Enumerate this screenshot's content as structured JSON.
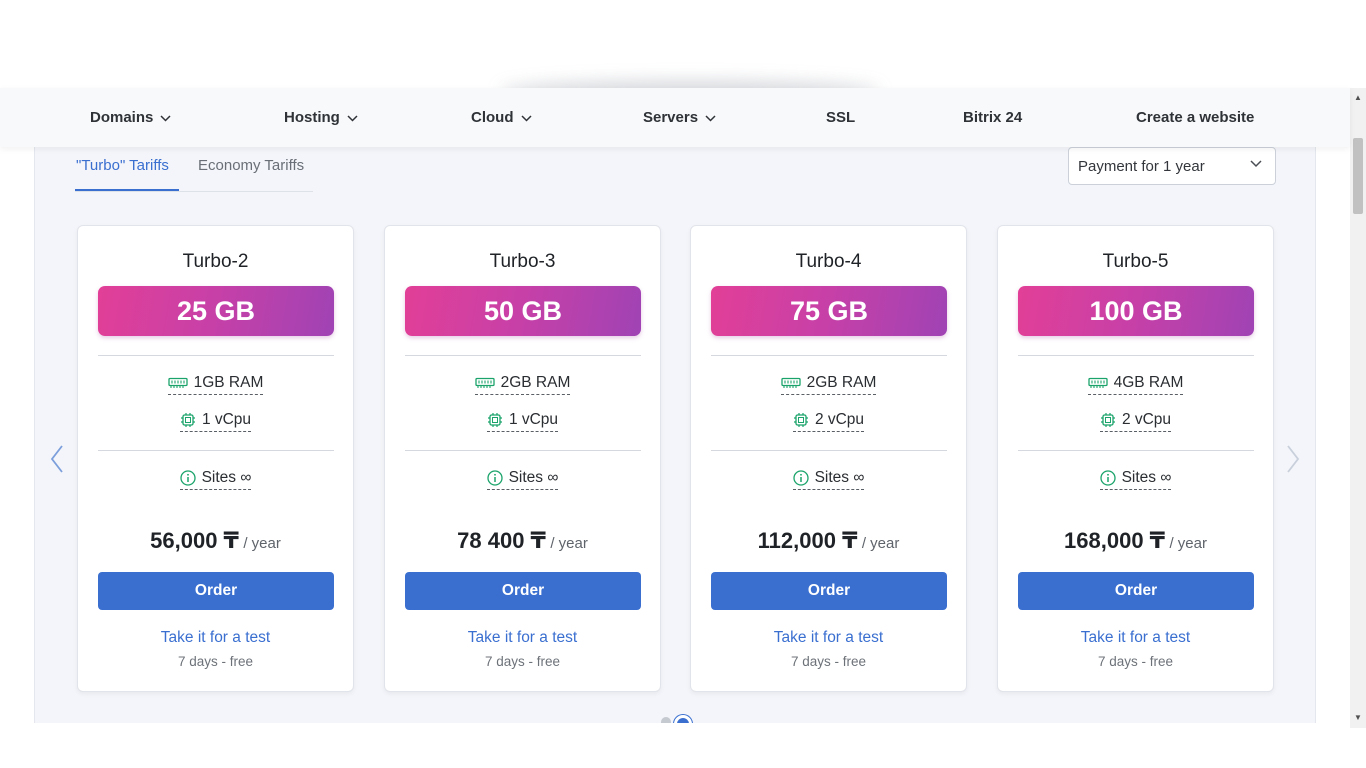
{
  "nav": {
    "items": [
      {
        "label": "Domains",
        "has_dropdown": true
      },
      {
        "label": "Hosting",
        "has_dropdown": true
      },
      {
        "label": "Cloud",
        "has_dropdown": true
      },
      {
        "label": "Servers",
        "has_dropdown": true
      },
      {
        "label": "SSL",
        "has_dropdown": false
      },
      {
        "label": "Bitrix 24",
        "has_dropdown": false
      },
      {
        "label": "Create a website",
        "has_dropdown": false
      }
    ]
  },
  "tabs": [
    {
      "label": "\"Turbo\" Tariffs",
      "active": true
    },
    {
      "label": "Economy Tariffs",
      "active": false
    }
  ],
  "payment_select": {
    "value": "Payment for 1 year"
  },
  "carousel": {
    "prev_icon": "chevron-left-icon",
    "next_icon": "chevron-right-icon",
    "active_page": 2,
    "page_count": 2
  },
  "plans": [
    {
      "name": "Turbo-2",
      "storage": "25 GB",
      "ram": "1GB RAM",
      "cpu": "1 vCpu",
      "sites": "Sites ∞",
      "price": "56,000 ₸",
      "period": "/ year",
      "order": "Order",
      "test": "Take it for a test",
      "trial": "7 days - free"
    },
    {
      "name": "Turbo-3",
      "storage": "50 GB",
      "ram": "2GB RAM",
      "cpu": "1 vCpu",
      "sites": "Sites ∞",
      "price": "78 400 ₸",
      "period": "/ year",
      "order": "Order",
      "test": "Take it for a test",
      "trial": "7 days - free"
    },
    {
      "name": "Turbo-4",
      "storage": "75 GB",
      "ram": "2GB RAM",
      "cpu": "2 vCpu",
      "sites": "Sites ∞",
      "price": "112,000 ₸",
      "period": "/ year",
      "order": "Order",
      "test": "Take it for a test",
      "trial": "7 days - free"
    },
    {
      "name": "Turbo-5",
      "storage": "100 GB",
      "ram": "4GB RAM",
      "cpu": "2 vCpu",
      "sites": "Sites ∞",
      "price": "168,000 ₸",
      "period": "/ year",
      "order": "Order",
      "test": "Take it for a test",
      "trial": "7 days - free"
    }
  ],
  "colors": {
    "accent": "#3a6fd0",
    "badge_gradient_start": "#e23f97",
    "badge_gradient_end": "#a043b4",
    "icon_green": "#1aa36a",
    "background": "#f3f5fa"
  },
  "icons": {
    "ram": "memory-icon",
    "cpu": "cpu-chip-icon",
    "sites": "info-icon"
  }
}
